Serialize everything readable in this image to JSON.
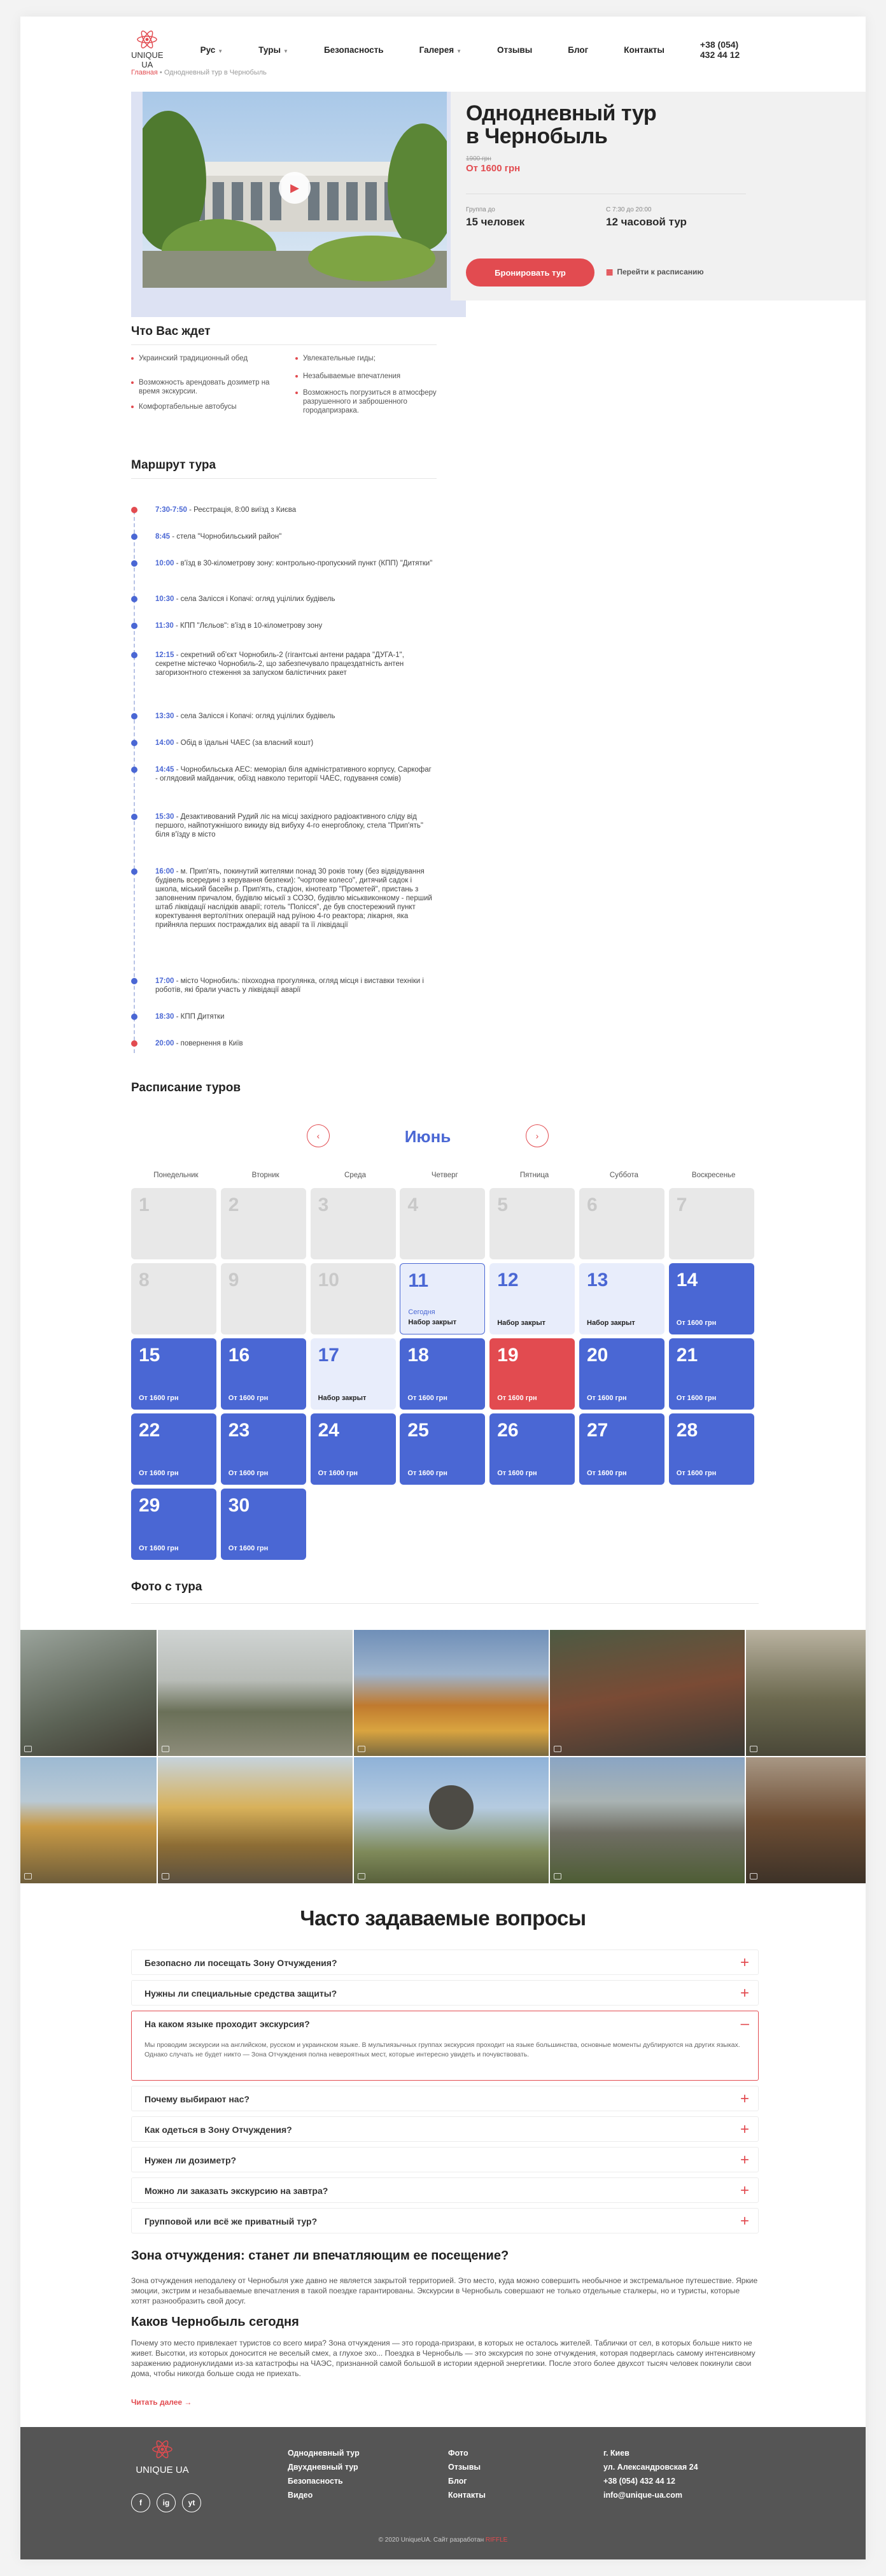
{
  "header": {
    "logo": "UNIQUE UA",
    "nav": [
      "Рус",
      "Туры",
      "Безопасность",
      "Галерея",
      "Отзывы",
      "Блог",
      "Контакты"
    ],
    "phone": "+38 (054) 432 44 12"
  },
  "breadcrumb": {
    "home": "Главная",
    "sep": " • ",
    "current": "Однодневный тур в Чернобыль"
  },
  "tour": {
    "title_1": "Однодневный тур",
    "title_2": "в Чернобыль",
    "old_price": "1900 грн",
    "price": "От 1600 грн",
    "group_label": "Группа до",
    "group_value": "15 человек",
    "time_label": "С 7:30 до 20:00",
    "time_value": "12 часовой тур",
    "book_button": "Бронировать тур",
    "schedule_link": "Перейти к расписанию"
  },
  "expect": {
    "title": "Что Вас ждет",
    "items": [
      "Украинский традиционный обед",
      "Возможность арендовать дозиметр на время экскурсии.",
      "Комфортабельные автобусы",
      "Увлекательные гиды;",
      "Незабываемые впечатления",
      "Возможность погрузиться в атмосферу разрушенного и заброшенного городапризрака."
    ]
  },
  "route": {
    "title": "Маршрут тура",
    "items": [
      {
        "time": "7:30-7:50",
        "text": " - Реєстрація, 8:00 виїзд з Києва"
      },
      {
        "time": "8:45",
        "text": " - стела \"Чорнобильський район\""
      },
      {
        "time": "10:00",
        "text": " - в'їзд в 30-кілометрову зону: контрольно-пропускний пункт (КПП) \"Дитятки\""
      },
      {
        "time": "10:30",
        "text": " - села Залісся і Копачі: огляд уцілілих будівель"
      },
      {
        "time": "11:30",
        "text": " - КПП \"Лєльов\": в'їзд в 10-кілометрову зону"
      },
      {
        "time": "12:15",
        "text": " - секретний об'єкт Чорнобиль-2 (гігантські антени радара \"ДУГА-1\", секретне містечко Чорнобиль-2, що забезпечувало працездатність антен загоризонтного стеження за запуском балістичних ракет"
      },
      {
        "time": "13:30",
        "text": " - села Залісся і Копачі: огляд уцілілих будівель"
      },
      {
        "time": "14:00",
        "text": " - Обід в їдальні ЧАЕС (за власний кошт)"
      },
      {
        "time": "14:45",
        "text": " - Чорнобильська АЕС: меморіал біля адміністративного корпусу, Саркофаг - оглядовий майданчик, обїзд навколо території ЧАЕС, годування сомів)"
      },
      {
        "time": "15:30",
        "text": " - Дезактивований Рудий ліс на місці західного радіоактивного сліду від першого, найпотужнішого викиду від вибуху 4-го енергоблоку, стела \"Прип'ять\" біля в'їзду в місто"
      },
      {
        "time": "16:00",
        "text": " - м. Прип'ять, покинутий жителями понад 30 років тому (без відвідування будівель всередині з керування безпеки): \"чортове колесо\", дитячий садок і школа, міський басейн р. Прип'ять, стадіон, кінотеатр \"Прометей\", пристань з заповненим причалом, будівлю міськії з СОЗО, будівлю міськвиконкому - перший штаб ліквідації наслідків аварії; готель \"Полісся\", де був спостережний пункт коректування вертолітних операцій над руїною 4-го реактора; лікарня, яка прийняла перших постраждалих від аварії та її ліквідації"
      },
      {
        "time": "17:00",
        "text": " - місто Чорнобиль: піхоходна прогулянка, огляд місця і виставки техніки і роботів, які брали участь у ліквідації аварії"
      },
      {
        "time": "18:30",
        "text": " - КПП Дитятки"
      },
      {
        "time": "20:00",
        "text": " - повернення в Київ"
      }
    ]
  },
  "schedule": {
    "title": "Расписание туров",
    "month": "Июнь",
    "weekdays": [
      "Понедельник",
      "Вторник",
      "Среда",
      "Четверг",
      "Пятница",
      "Суббота",
      "Воскресенье"
    ],
    "days": [
      {
        "n": "1",
        "state": "gray"
      },
      {
        "n": "2",
        "state": "gray"
      },
      {
        "n": "3",
        "state": "gray"
      },
      {
        "n": "4",
        "state": "gray"
      },
      {
        "n": "5",
        "state": "gray"
      },
      {
        "n": "6",
        "state": "gray"
      },
      {
        "n": "7",
        "state": "gray"
      },
      {
        "n": "8",
        "state": "gray"
      },
      {
        "n": "9",
        "state": "gray"
      },
      {
        "n": "10",
        "state": "gray"
      },
      {
        "n": "11",
        "state": "today",
        "note": "Сегодня",
        "label": "Набор закрыт"
      },
      {
        "n": "12",
        "state": "light",
        "label": "Набор закрыт"
      },
      {
        "n": "13",
        "state": "light",
        "label": "Набор закрыт"
      },
      {
        "n": "14",
        "state": "blue",
        "label": "От 1600 грн"
      },
      {
        "n": "15",
        "state": "blue",
        "label": "От 1600 грн"
      },
      {
        "n": "16",
        "state": "blue",
        "label": "От 1600 грн"
      },
      {
        "n": "17",
        "state": "light",
        "label": "Набор закрыт"
      },
      {
        "n": "18",
        "state": "blue",
        "label": "От 1600 грн"
      },
      {
        "n": "19",
        "state": "red",
        "label": "От 1600 грн"
      },
      {
        "n": "20",
        "state": "blue",
        "label": "От 1600 грн"
      },
      {
        "n": "21",
        "state": "blue",
        "label": "От 1600 грн"
      },
      {
        "n": "22",
        "state": "blue",
        "label": "От 1600 грн"
      },
      {
        "n": "23",
        "state": "blue",
        "label": "От 1600 грн"
      },
      {
        "n": "24",
        "state": "blue",
        "label": "От 1600 грн"
      },
      {
        "n": "25",
        "state": "blue",
        "label": "От 1600 грн"
      },
      {
        "n": "26",
        "state": "blue",
        "label": "От 1600 грн"
      },
      {
        "n": "27",
        "state": "blue",
        "label": "От 1600 грн"
      },
      {
        "n": "28",
        "state": "blue",
        "label": "От 1600 грн"
      },
      {
        "n": "29",
        "state": "blue",
        "label": "От 1600 грн"
      },
      {
        "n": "30",
        "state": "blue",
        "label": "От 1600 грн"
      }
    ]
  },
  "gallery": {
    "title": "Фото с тура"
  },
  "faq": {
    "title": "Часто задаваемые вопросы",
    "items": [
      {
        "q": "Безопасно ли посещать Зону Отчуждения?"
      },
      {
        "q": "Нужны ли специальные средства защиты?"
      },
      {
        "q": "На каком языке проходит экскурсия?",
        "a": "Мы проводим экскурсии на английском, русском и украинском языке. В мультиязычных группах экскурсия проходит на языке большинства, основные моменты дублируются на других языках. Однако случать не будет никто — Зона Отчуждения полна невероятных мест, которые интересно увидеть и почувствовать."
      },
      {
        "q": "Почему выбирают нас?"
      },
      {
        "q": "Как одеться в Зону Отчуждения?"
      },
      {
        "q": "Нужен ли дозиметр?"
      },
      {
        "q": "Можно ли заказать экскурсию на завтра?"
      },
      {
        "q": "Групповой или всё же приватный тур?"
      }
    ]
  },
  "article": {
    "h1": "Зона отчуждения: станет ли впечатляющим ее посещение?",
    "p1": "Зона отчуждения неподалеку от Чернобыля уже давно не является закрытой территорией. Это место, куда можно совершить необычное и экстремальное путешествие. Яркие эмоции, экстрим и незабываемые впечатления в такой поездке гарантированы. Экскурсии в Чернобыль совершают не только отдельные сталкеры, но и туристы, которые хотят разнообразить свой досуг.",
    "h2": "Каков Чернобыль сегодня",
    "p2": "Почему это место привлекает туристов со всего мира? Зона отчуждения — это города-призраки, в которых не осталось жителей. Таблички от сел, в которых больше никто не живет. Высотки, из которых доносится не веселый смех, а глухое эхо... Поездка в Чернобыль — это экскурсия по зоне отчуждения, которая подверглась самому интенсивному заражению радионуклидами из-за катастрофы на ЧАЭС, признанной самой большой в истории ядерной энергетики. После этого более двухсот тысяч человек покинули свои дома, чтобы никогда больше сюда не приехать.",
    "more": "Читать далее"
  },
  "footer": {
    "logo": "UNIQUE UA",
    "col1": [
      "Однодневный тур",
      "Двухдневный тур",
      "Безопасность",
      "Видео"
    ],
    "col2": [
      "Фото",
      "Отзывы",
      "Блог",
      "Контакты"
    ],
    "col3": [
      "г. Киев",
      "ул. Александровская 24",
      "+38 (054) 432 44 12",
      "info@unique-ua.com"
    ],
    "social": [
      "f",
      "ig",
      "yt"
    ],
    "copyright": "© 2020 UniqueUA. Сайт разработан",
    "dev": "RIFFLE"
  },
  "colors": {
    "accent": "#e24b50",
    "blue": "#4a67d4"
  }
}
